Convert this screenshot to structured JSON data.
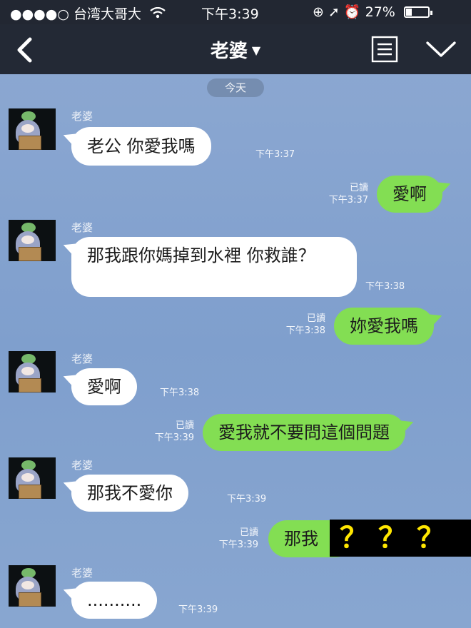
{
  "status_bar": {
    "signal": "●●●●○",
    "carrier": "台湾大哥大",
    "time": "下午3:39",
    "right_icons": "⊕ ➚ ⏰",
    "battery": "27%",
    "battery_level": 0.27
  },
  "nav": {
    "title": "老婆",
    "caret": "▼",
    "icons": [
      "back-arrow",
      "menu",
      "collapse-chevron"
    ]
  },
  "date_label": "今天",
  "messages": [
    {
      "direction": "in",
      "sender": "老婆",
      "text": "老公 你愛我嗎",
      "time": "下午3:37"
    },
    {
      "direction": "out",
      "read": "已讀",
      "text": "愛啊",
      "time": "下午3:37"
    },
    {
      "direction": "in",
      "sender": "老婆",
      "text": "那我跟你媽掉到水裡 你救誰？",
      "time": "下午3:38"
    },
    {
      "direction": "out",
      "read": "已讀",
      "text": "妳愛我嗎",
      "time": "下午3:38"
    },
    {
      "direction": "in",
      "sender": "老婆",
      "text": "愛啊",
      "time": "下午3:38"
    },
    {
      "direction": "out",
      "read": "已讀",
      "text": "愛我就不要問這個問題",
      "time": "下午3:39"
    },
    {
      "direction": "in",
      "sender": "老婆",
      "text": "那我不愛你",
      "time": "下午3:39"
    },
    {
      "direction": "out",
      "read": "已讀",
      "text": "那我",
      "time": "下午3:39"
    },
    {
      "direction": "in",
      "sender": "老婆",
      "text": "..........",
      "time": "下午3:39"
    }
  ],
  "overlay_text": "？？？",
  "colors": {
    "header": "#232935",
    "chat_bg": "#869fcb",
    "bubble_in": "#ffffff",
    "bubble_out": "#83de53",
    "overlay_bg": "#000000",
    "overlay_text": "#ffe600"
  }
}
